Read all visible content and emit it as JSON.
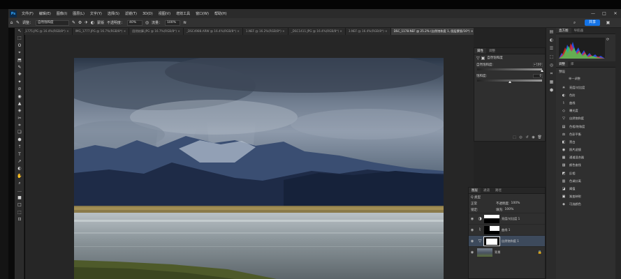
{
  "menubar": {
    "logo": "Ps",
    "items": [
      "文件(F)",
      "编辑(E)",
      "图像(I)",
      "图层(L)",
      "文字(Y)",
      "选择(S)",
      "滤镜(T)",
      "3D(D)",
      "视图(V)",
      "增效工具",
      "窗口(W)",
      "帮助(H)"
    ]
  },
  "window_controls": [
    "—",
    "□",
    "✕"
  ],
  "optionsbar": {
    "adjust_label": "调整：",
    "adjust_value": "自然饱和度",
    "edge_label": "蒙版",
    "opacity_label": "不透明度：",
    "opacity_value": "40%",
    "flow_label": "流量：",
    "flow_value": "100%",
    "share_label": "共享"
  },
  "tabs": [
    {
      "label": "IMG_1775.JPG @ 16.4%(RGB/8*) ×",
      "active": false
    },
    {
      "label": "IMG_1777.JPG @ 16.7%(RGB/8*) ×",
      "active": false
    },
    {
      "label": "固然结算.JPG @ 16.7%(RGB/8*) ×",
      "active": false
    },
    {
      "label": "_DSC4988.ARW @ 16.4%(RGB/8*) ×",
      "active": false
    },
    {
      "label": "1.NEF @ 16.2%(RGB/8*) ×",
      "active": false
    },
    {
      "label": "_DSC1411.JPG @ 16.4%(RGB/8*) ×",
      "active": false
    },
    {
      "label": "3.NEF @ 16.4%(RGB/8*) ×",
      "active": false
    },
    {
      "label": "DSC_1178.NEF @ 25.2% (自然饱和度 1, 图层蒙版/16*) ×",
      "active": true
    }
  ],
  "tools": [
    "↖",
    "⬚",
    "ʘ",
    "⌖",
    "⬒",
    "✎",
    "✚",
    "✦",
    "⊘",
    "◉",
    "▲",
    "◈",
    "✂",
    "⌗",
    "❏",
    "⬢",
    "⇡",
    "T",
    "↗",
    "◐",
    "✋",
    "⌕",
    "…",
    "■",
    "□",
    "⬚",
    "⊡"
  ],
  "properties": {
    "tab1": "属性",
    "tab2": "调整",
    "header": "自然饱和度",
    "row1_label": "自然饱和度:",
    "row1_value": "+100",
    "row1_level": 1.0,
    "row2_label": "饱和度:",
    "row2_value": "0",
    "row2_level": 0.5,
    "buttons": [
      "⬚",
      "◎",
      "↺",
      "◉",
      "🗑"
    ]
  },
  "layers": {
    "tabs": [
      "图层",
      "通道",
      "路径"
    ],
    "search_label": "Q 类型",
    "blend_mode": "正常",
    "opacity_label": "不透明度:",
    "opacity_value": "100%",
    "lock_label": "锁定:",
    "fill_label": "填充:",
    "fill_value": "100%",
    "items": [
      {
        "name": "亮度/对比度 1",
        "adj": "◑",
        "selected": false
      },
      {
        "name": "曲线 1",
        "adj": "⌇",
        "selected": false
      },
      {
        "name": "自然饱和度 1",
        "adj": "▽",
        "selected": true
      },
      {
        "name": "背景",
        "adj": "",
        "selected": false
      }
    ]
  },
  "rightpanel": {
    "top_tabs": [
      "直方图",
      "导航器"
    ],
    "adj_tabs": [
      "调整",
      "库"
    ],
    "section_label": "预设",
    "subsection_label": "单一调整",
    "adjustments": [
      {
        "icon": "☀",
        "label": "亮度/对比度"
      },
      {
        "icon": "◐",
        "label": "色阶"
      },
      {
        "icon": "⌇",
        "label": "曲线"
      },
      {
        "icon": "◇",
        "label": "曝光度"
      },
      {
        "icon": "▽",
        "label": "自然饱和度"
      },
      {
        "icon": "▤",
        "label": "色相/饱和度"
      },
      {
        "icon": "⚖",
        "label": "色彩平衡"
      },
      {
        "icon": "◧",
        "label": "黑白"
      },
      {
        "icon": "◉",
        "label": "照片滤镜"
      },
      {
        "icon": "▦",
        "label": "通道混合器"
      },
      {
        "icon": "▨",
        "label": "颜色查找"
      },
      {
        "icon": "◩",
        "label": "反相"
      },
      {
        "icon": "▥",
        "label": "色调分离"
      },
      {
        "icon": "◪",
        "label": "阈值"
      },
      {
        "icon": "▣",
        "label": "渐变映射"
      },
      {
        "icon": "◈",
        "label": "可选颜色"
      }
    ]
  },
  "right_strip_icons": [
    "▤",
    "◐",
    "☰",
    "⬚",
    "◎",
    "⌗",
    "▦",
    "⬢"
  ],
  "colors": {
    "accent": "#1473e6",
    "selected_layer": "#3d4a5c"
  }
}
